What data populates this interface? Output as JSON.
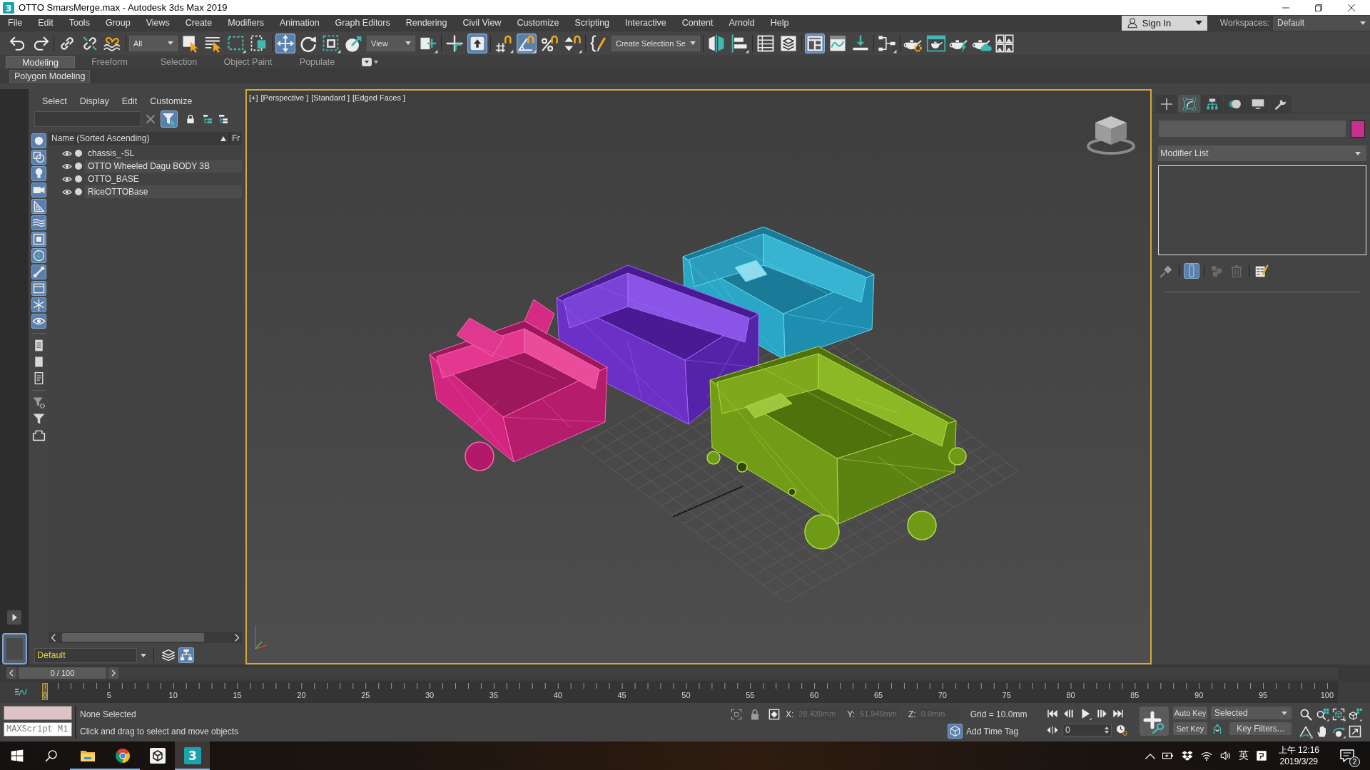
{
  "window": {
    "logo_text": "3",
    "title": "OTTO SmarsMerge.max - Autodesk 3ds Max 2019"
  },
  "menu_bar": {
    "items": [
      "File",
      "Edit",
      "Tools",
      "Group",
      "Views",
      "Create",
      "Modifiers",
      "Animation",
      "Graph Editors",
      "Rendering",
      "Civil View",
      "Customize",
      "Scripting",
      "Interactive",
      "Content",
      "Arnold",
      "Help"
    ],
    "sign_in": "Sign In",
    "workspaces_label": "Workspaces:",
    "workspace": "Default"
  },
  "main_toolbar": [
    [
      {
        "kind": "undo",
        "on": false
      },
      {
        "kind": "redo",
        "on": false
      }
    ],
    [
      {
        "kind": "link",
        "on": false
      },
      {
        "kind": "unlink",
        "on": false
      },
      {
        "kind": "bind",
        "on": false
      }
    ],
    [
      {
        "kind": "dropdown",
        "value": "All"
      },
      {
        "kind": "select",
        "on": false
      },
      {
        "kind": "select_by_name",
        "on": false
      },
      {
        "kind": "region",
        "on": false
      },
      {
        "kind": "crossing",
        "on": false
      }
    ],
    [
      {
        "kind": "move",
        "on": true
      },
      {
        "kind": "rotate",
        "on": false
      },
      {
        "kind": "scale",
        "on": false
      },
      {
        "kind": "place",
        "on": false
      },
      {
        "kind": "dropdown",
        "value": "View"
      },
      {
        "kind": "pivot",
        "on": false
      }
    ],
    [
      {
        "kind": "manipulate",
        "on": false
      },
      {
        "kind": "override",
        "on": true
      }
    ],
    [
      {
        "kind": "snap",
        "on": false
      },
      {
        "kind": "angle_snap",
        "on": true
      },
      {
        "kind": "percent_snap",
        "on": false
      },
      {
        "kind": "spinner_snap",
        "on": false
      }
    ],
    [
      {
        "kind": "selection_sets",
        "on": false
      },
      {
        "kind": "dropdown",
        "value": "Create Selection Se"
      }
    ],
    [
      {
        "kind": "mirror",
        "on": false
      },
      {
        "kind": "align",
        "on": false
      }
    ],
    [
      {
        "kind": "scene_explorer",
        "on": false
      },
      {
        "kind": "layer_explorer",
        "on": false
      }
    ],
    [
      {
        "kind": "ribbon",
        "on": true
      },
      {
        "kind": "curve_editor",
        "on": false
      },
      {
        "kind": "schematic_view",
        "on": false
      }
    ],
    [
      {
        "kind": "material_editor",
        "on": false
      }
    ],
    [
      {
        "kind": "render_setup",
        "on": false
      },
      {
        "kind": "frame_window",
        "on": false
      },
      {
        "kind": "render",
        "on": false
      },
      {
        "kind": "cloud_render",
        "on": false
      },
      {
        "kind": "gallery",
        "on": false
      }
    ]
  ],
  "ribbon": {
    "tabs": [
      {
        "label": "Modeling",
        "selected": true
      },
      {
        "label": "Freeform",
        "selected": false
      },
      {
        "label": "Selection",
        "selected": false
      },
      {
        "label": "Object Paint",
        "selected": false
      },
      {
        "label": "Populate",
        "selected": false
      }
    ],
    "panel_button": "Polygon Modeling"
  },
  "scene_explorer": {
    "menu": [
      "Select",
      "Display",
      "Edit",
      "Customize"
    ],
    "search_filter": {
      "on": true
    },
    "side_toolbar": [
      [
        {
          "kind": "geometry",
          "on": true
        },
        {
          "kind": "shapes",
          "on": true
        },
        {
          "kind": "lights",
          "on": true
        },
        {
          "kind": "cameras",
          "on": true
        },
        {
          "kind": "helpers",
          "on": true
        },
        {
          "kind": "space_warps",
          "on": true
        },
        {
          "kind": "groups",
          "on": true
        },
        {
          "kind": "xrefs",
          "on": true
        },
        {
          "kind": "bones",
          "on": true
        },
        {
          "kind": "containers",
          "on": true
        },
        {
          "kind": "frozen",
          "on": true
        },
        {
          "kind": "hidden",
          "on": true
        }
      ],
      [
        {
          "kind": "children",
          "on": false
        },
        {
          "kind": "influences",
          "on": false
        },
        {
          "kind": "dependents",
          "on": false
        }
      ],
      [
        {
          "kind": "filter_settings",
          "on": false
        },
        {
          "kind": "filter_funnel",
          "on": false
        },
        {
          "kind": "brackets",
          "on": false
        }
      ]
    ],
    "columns": [
      "Name (Sorted Ascending)",
      "Fr"
    ],
    "rows": [
      {
        "name": "chassis_-SL",
        "visible": true,
        "frozen": false
      },
      {
        "name": "OTTO Wheeled Dagu BODY 3B",
        "visible": true,
        "frozen": false
      },
      {
        "name": "OTTO_BASE",
        "visible": true,
        "frozen": false
      },
      {
        "name": "RiceOTTOBase",
        "visible": true,
        "frozen": false
      }
    ],
    "layer": "Default",
    "layer_tools": [
      {
        "kind": "layers_small",
        "on": false
      },
      {
        "kind": "layer_tree",
        "on": true
      }
    ]
  },
  "viewport": {
    "active": true,
    "labels": [
      "[+]",
      "[Perspective ]",
      "[Standard ]",
      "[Edged Faces ]"
    ]
  },
  "command_panel": {
    "tabs": [
      {
        "kind": "create",
        "selected": false
      },
      {
        "kind": "modify",
        "selected": true
      },
      {
        "kind": "hierarchy",
        "selected": false
      },
      {
        "kind": "motion",
        "selected": false
      },
      {
        "kind": "display",
        "selected": false
      },
      {
        "kind": "utilities",
        "selected": false
      }
    ],
    "modifier_list": "Modifier List",
    "stack_tools": [
      [
        {
          "kind": "pin",
          "on": false,
          "disabled": false
        }
      ],
      [
        {
          "kind": "end_result",
          "on": true,
          "disabled": false
        }
      ],
      [
        {
          "kind": "make_unique",
          "on": false,
          "disabled": true
        },
        {
          "kind": "remove",
          "on": false,
          "disabled": true
        }
      ],
      [
        {
          "kind": "configure",
          "on": false,
          "disabled": false
        }
      ]
    ]
  },
  "time_slider": {
    "position": "0 / 100",
    "level": 0
  },
  "track_bar": {
    "frame_labels": [
      "0",
      "5",
      "10",
      "15",
      "20",
      "25",
      "30",
      "35",
      "40",
      "45",
      "50",
      "55",
      "60",
      "65",
      "70",
      "75",
      "80",
      "85",
      "90",
      "95",
      "100"
    ]
  },
  "status_bar": {
    "maxscript": "MAXScript Mi",
    "selection": "None Selected",
    "prompt": "Click and drag to select and move objects",
    "coordinates": [
      {
        "axis": "X:",
        "value": "28.439mm",
        "disabled": true
      },
      {
        "axis": "Y:",
        "value": "51.949mm",
        "disabled": true
      },
      {
        "axis": "Z:",
        "value": "0.0mm",
        "disabled": true
      }
    ],
    "grid": "Grid = 10.0mm",
    "time_tag": "Add Time Tag"
  },
  "animation_controls": {
    "frame": "0",
    "auto_key": "Auto Key",
    "set_key": "Set Key",
    "key_mode": "Selected",
    "key_filters": "Key Filters..."
  },
  "taskbar": {
    "apps": [
      {
        "kind": "explorer",
        "running": true,
        "selected": false
      },
      {
        "kind": "chrome",
        "running": true,
        "selected": false
      },
      {
        "kind": "unity",
        "running": false,
        "selected": false
      },
      {
        "kind": "max",
        "logo_text": "3",
        "running": true,
        "selected": true
      }
    ],
    "input_method": "英",
    "time": "上午 12:16",
    "date": "2019/3/29",
    "notifications": "2"
  }
}
